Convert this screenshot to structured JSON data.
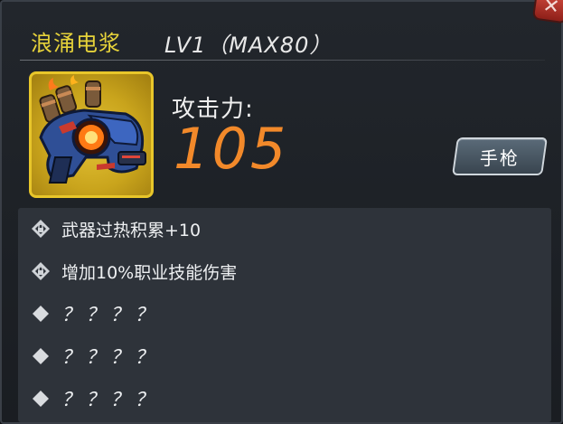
{
  "header": {
    "weapon_name": "浪涌电浆",
    "level_text": "LV1（MAX80）"
  },
  "stats": {
    "attack_label": "攻击力:",
    "attack_value": "105"
  },
  "weapon_type_button": "手枪",
  "attributes": [
    {
      "text": "武器过热积累+10",
      "icon": "lock-diamond-icon",
      "locked": true
    },
    {
      "text": "增加10%职业技能伤害",
      "icon": "lock-diamond-icon",
      "locked": true
    },
    {
      "text": "？？？？",
      "icon": "diamond-icon",
      "locked": false
    },
    {
      "text": "？？？？",
      "icon": "diamond-icon",
      "locked": false
    },
    {
      "text": "？？？？",
      "icon": "diamond-icon",
      "locked": false
    }
  ],
  "colors": {
    "weapon_name": "#e6d23a",
    "attack_value": "#f2892a",
    "icon_frame": "#e8c62a"
  }
}
